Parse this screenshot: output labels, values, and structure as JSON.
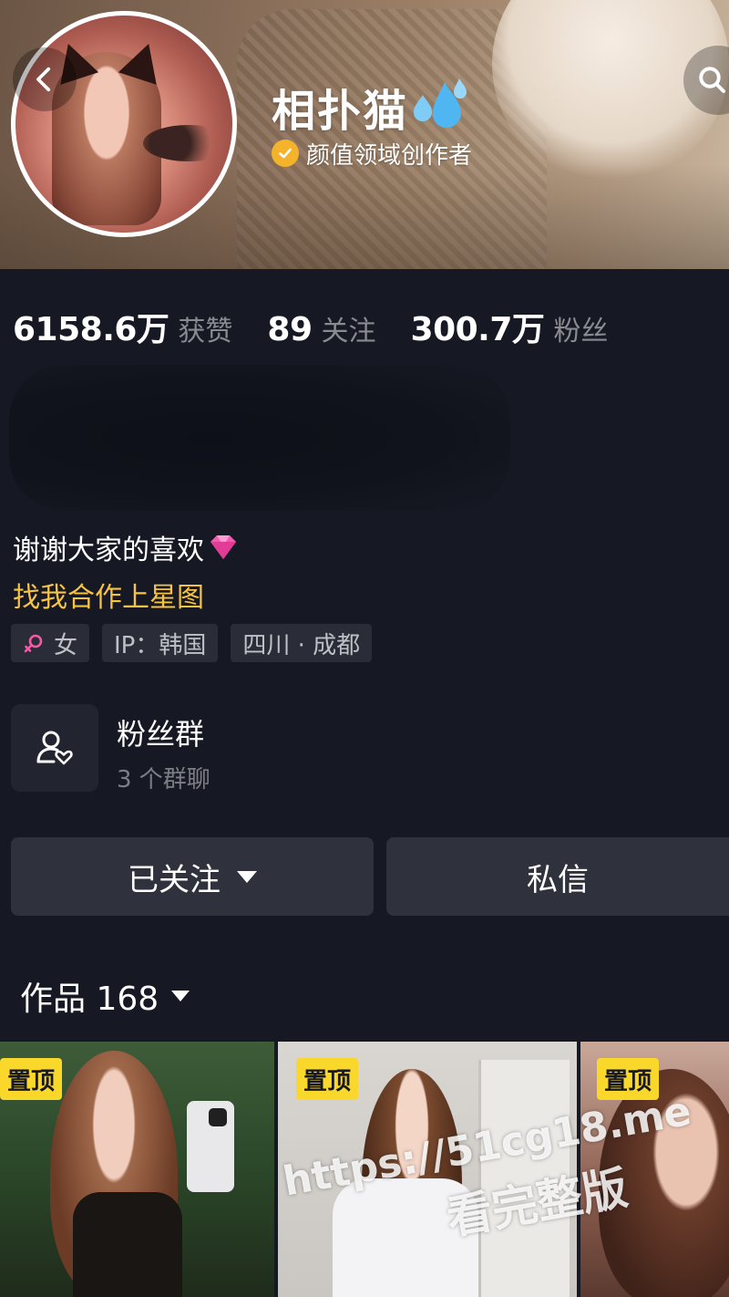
{
  "profile": {
    "name": "相扑猫",
    "name_emoji": "sweat-droplets",
    "verify_label": "颜值领域创作者"
  },
  "stats": [
    {
      "value": "6158.6万",
      "label": "获赞"
    },
    {
      "value": "89",
      "label": "关注"
    },
    {
      "value": "300.7万",
      "label": "粉丝"
    }
  ],
  "bio": {
    "line1": "谢谢大家的喜欢",
    "cooperate": "找我合作上星图"
  },
  "tags": {
    "gender": "女",
    "ip": "IP：韩国",
    "location": "四川 · 成都"
  },
  "fan_group": {
    "title": "粉丝群",
    "subtitle": "3 个群聊"
  },
  "actions": {
    "follow": "已关注",
    "message": "私信"
  },
  "works": {
    "label": "作品 168",
    "pin_badge": "置顶"
  },
  "watermark": {
    "url": "https://51cg18.me",
    "text": "看完整版"
  },
  "colors": {
    "background": "#161823",
    "accent_gold": "#f6c343",
    "pin_yellow": "#f9d72b",
    "verify_orange": "#f5b32c"
  }
}
